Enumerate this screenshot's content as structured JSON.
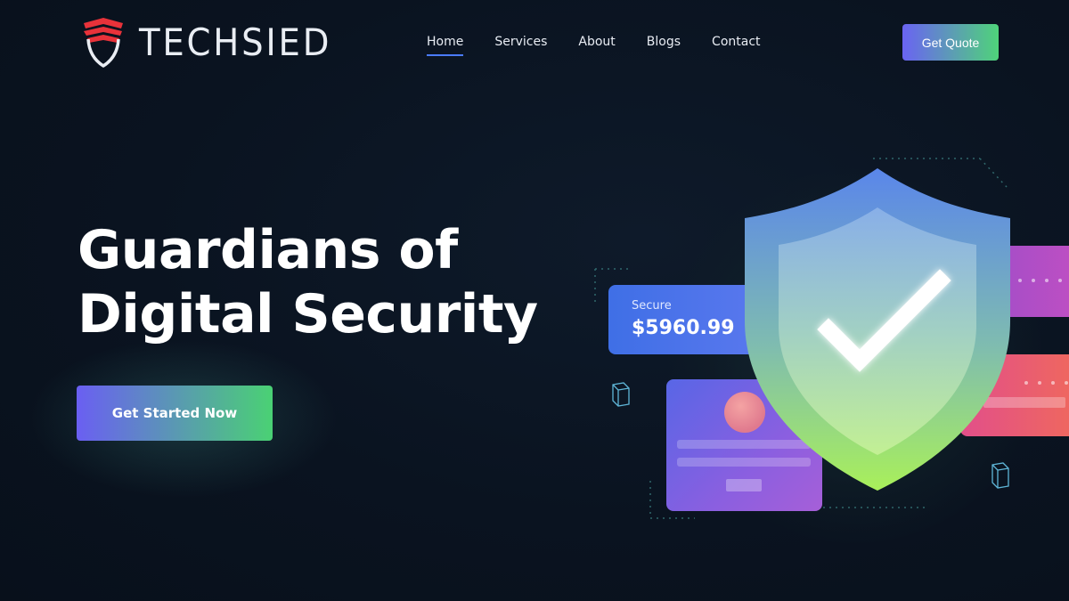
{
  "brand": {
    "name": "TECHSIED",
    "accent_red": "#e8323a",
    "accent_white": "#e9edf3"
  },
  "nav": {
    "items": [
      {
        "label": "Home",
        "active": true
      },
      {
        "label": "Services",
        "active": false
      },
      {
        "label": "About",
        "active": false
      },
      {
        "label": "Blogs",
        "active": false
      },
      {
        "label": "Contact",
        "active": false
      }
    ],
    "active_underline_color": "#4a7bff"
  },
  "header": {
    "quote_button_label": "Get Quote"
  },
  "hero": {
    "title_line1": "Guardians of",
    "title_line2": "Digital Security",
    "cta_label": "Get Started Now"
  },
  "illustration": {
    "secure_card": {
      "label": "Secure",
      "amount": "$5960.99"
    },
    "icons": [
      "shield-check-icon",
      "user-avatar-icon",
      "password-dots-icon"
    ]
  },
  "colors": {
    "background": "#0b1421",
    "button_gradient_start": "#6a63f2",
    "button_gradient_end": "#4fd37a",
    "shield_top": "#5b8ae8",
    "shield_bottom": "#a5ef5a"
  }
}
